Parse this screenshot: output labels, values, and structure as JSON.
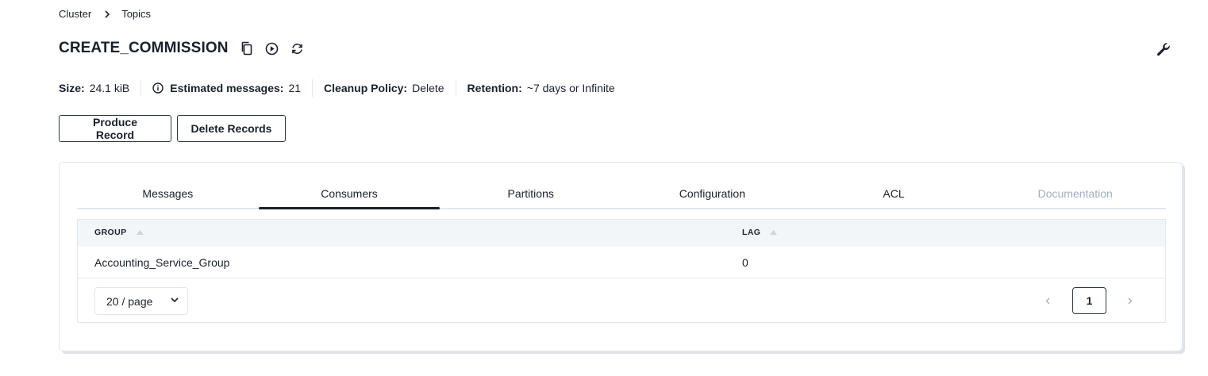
{
  "breadcrumb": {
    "items": [
      "Cluster",
      "Topics"
    ]
  },
  "topic": {
    "name": "CREATE_COMMISSION",
    "icons": [
      "copy-icon",
      "play-icon",
      "refresh-icon"
    ],
    "settings_icon": "wrench-icon"
  },
  "stats": {
    "size_label": "Size:",
    "size_value": "24.1 kiB",
    "messages_label": "Estimated messages:",
    "messages_value": "21",
    "cleanup_label": "Cleanup Policy:",
    "cleanup_value": "Delete",
    "retention_label": "Retention:",
    "retention_value": "~7 days or Infinite"
  },
  "actions": {
    "produce_label": "Produce Record",
    "delete_label": "Delete Records"
  },
  "tabs": [
    {
      "label": "Messages",
      "active": false,
      "disabled": false
    },
    {
      "label": "Consumers",
      "active": true,
      "disabled": false
    },
    {
      "label": "Partitions",
      "active": false,
      "disabled": false
    },
    {
      "label": "Configuration",
      "active": false,
      "disabled": false
    },
    {
      "label": "ACL",
      "active": false,
      "disabled": false
    },
    {
      "label": "Documentation",
      "active": false,
      "disabled": true
    }
  ],
  "table": {
    "columns": [
      "GROUP",
      "LAG"
    ],
    "rows": [
      {
        "group": "Accounting_Service_Group",
        "lag": "0"
      }
    ]
  },
  "pagination": {
    "page_size": "20 / page",
    "current_page": "1"
  },
  "colors": {
    "text": "#1a202c",
    "border": "#e2e8f0",
    "header_bg": "#f3f6f9",
    "disabled": "#a0aec0"
  }
}
